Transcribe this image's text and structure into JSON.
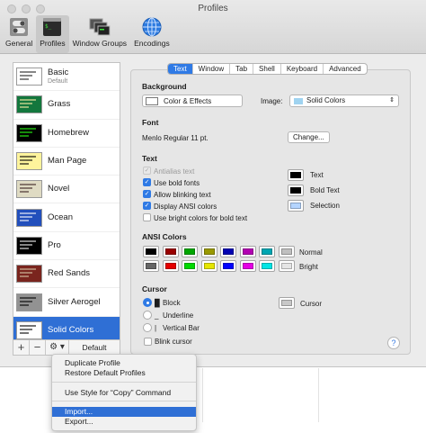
{
  "window": {
    "title": "Profiles"
  },
  "toolbar": [
    {
      "label": "General",
      "icon": "general-switch-icon"
    },
    {
      "label": "Profiles",
      "icon": "profiles-terminal-icon"
    },
    {
      "label": "Window Groups",
      "icon": "window-groups-icon"
    },
    {
      "label": "Encodings",
      "icon": "globe-icon"
    }
  ],
  "profiles": [
    {
      "name": "Basic",
      "sub": "Default",
      "bg": "#ffffff",
      "fg": "#222222"
    },
    {
      "name": "Grass",
      "sub": "",
      "bg": "#13773d",
      "fg": "#fff0a5"
    },
    {
      "name": "Homebrew",
      "sub": "",
      "bg": "#000000",
      "fg": "#28fe14"
    },
    {
      "name": "Man Page",
      "sub": "",
      "bg": "#fef49c",
      "fg": "#000000"
    },
    {
      "name": "Novel",
      "sub": "",
      "bg": "#dfdbc3",
      "fg": "#3b2322"
    },
    {
      "name": "Ocean",
      "sub": "",
      "bg": "#224fbc",
      "fg": "#ffffff"
    },
    {
      "name": "Pro",
      "sub": "",
      "bg": "#000000",
      "fg": "#f2f2f2"
    },
    {
      "name": "Red Sands",
      "sub": "",
      "bg": "#7a251e",
      "fg": "#d7c9a7"
    },
    {
      "name": "Silver Aerogel",
      "sub": "",
      "bg": "#929292",
      "fg": "#000000"
    },
    {
      "name": "Solid Colors",
      "sub": "",
      "bg": "#ffffff",
      "fg": "#000000"
    }
  ],
  "sidebar_footer": {
    "add": "+",
    "remove": "−",
    "gear": "⚙ ▾",
    "default": "Default"
  },
  "tabs": [
    "Text",
    "Window",
    "Tab",
    "Shell",
    "Keyboard",
    "Advanced"
  ],
  "background": {
    "heading": "Background",
    "color_effects": "Color & Effects",
    "image_label": "Image:",
    "image_value": "Solid Colors"
  },
  "font": {
    "heading": "Font",
    "value": "Menlo Regular 11 pt.",
    "change": "Change..."
  },
  "text": {
    "heading": "Text",
    "options": [
      {
        "label": "Antialias text",
        "checked": true,
        "disabled": true
      },
      {
        "label": "Use bold fonts",
        "checked": true,
        "disabled": false
      },
      {
        "label": "Allow blinking text",
        "checked": true,
        "disabled": false
      },
      {
        "label": "Display ANSI colors",
        "checked": true,
        "disabled": false
      },
      {
        "label": "Use bright colors for bold text",
        "checked": false,
        "disabled": false
      }
    ],
    "colors": [
      {
        "label": "Text",
        "color": "#000000"
      },
      {
        "label": "Bold Text",
        "color": "#000000"
      },
      {
        "label": "Selection",
        "color": "#b5d5ff"
      }
    ]
  },
  "ansi": {
    "heading": "ANSI Colors",
    "normal_label": "Normal",
    "bright_label": "Bright",
    "normal": [
      "#000000",
      "#990000",
      "#00a600",
      "#999900",
      "#0000b2",
      "#b200b2",
      "#00a6b2",
      "#bfbfbf"
    ],
    "bright": [
      "#666666",
      "#e50000",
      "#00d900",
      "#e5e500",
      "#0000ff",
      "#e500e5",
      "#00e5e5",
      "#e5e5e5"
    ]
  },
  "cursor": {
    "heading": "Cursor",
    "styles": [
      {
        "label": "Block",
        "glyph": "█",
        "selected": true
      },
      {
        "label": "Underline",
        "glyph": "_",
        "selected": false
      },
      {
        "label": "Vertical Bar",
        "glyph": "|",
        "selected": false
      }
    ],
    "color_label": "Cursor",
    "color": "#c8c8c8",
    "blink_label": "Blink cursor"
  },
  "help": "?",
  "context_menu": [
    {
      "label": "Duplicate Profile",
      "highlighted": false
    },
    {
      "label": "Restore Default Profiles",
      "highlighted": false
    },
    {
      "label": "Use Style for “Copy” Command",
      "highlighted": false
    },
    {
      "label": "Import...",
      "highlighted": true
    },
    {
      "label": "Export...",
      "highlighted": false
    }
  ]
}
